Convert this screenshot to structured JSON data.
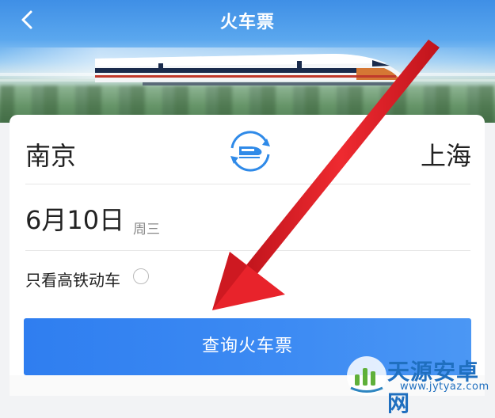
{
  "header": {
    "title": "火车票",
    "back_icon": "chevron-left-icon"
  },
  "search": {
    "from_city": "南京",
    "to_city": "上海",
    "swap_icon": "train-swap-icon",
    "date": "6月10日",
    "weekday": "周三",
    "high_speed_only_label": "只看高铁动车",
    "high_speed_only_checked": false,
    "submit_label": "查询火车票"
  },
  "colors": {
    "accent": "#3a87f2",
    "annotation_arrow": "#e8232b"
  },
  "watermark": {
    "name": "天源安卓网",
    "url": "www.jytyaz.com"
  }
}
